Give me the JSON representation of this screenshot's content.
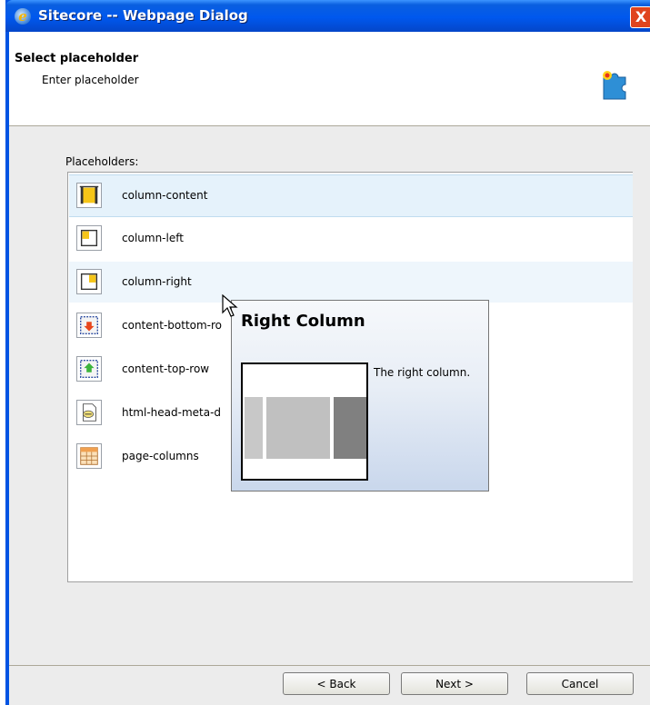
{
  "window": {
    "title": "Sitecore -- Webpage Dialog",
    "close_label": "X"
  },
  "header": {
    "title": "Select placeholder",
    "subtitle": "Enter placeholder"
  },
  "list": {
    "label": "Placeholders:",
    "items": [
      {
        "label": "column-content",
        "icon": "column-content-icon"
      },
      {
        "label": "column-left",
        "icon": "column-left-icon"
      },
      {
        "label": "column-right",
        "icon": "column-right-icon"
      },
      {
        "label": "content-bottom-ro",
        "icon": "content-bottom-row-icon"
      },
      {
        "label": "content-top-row",
        "icon": "content-top-row-icon"
      },
      {
        "label": "html-head-meta-d",
        "icon": "html-head-meta-icon"
      },
      {
        "label": "page-columns",
        "icon": "page-columns-icon"
      }
    ]
  },
  "tooltip": {
    "title": "Right Column",
    "description": "The right column."
  },
  "buttons": {
    "back": "< Back",
    "next": "Next >",
    "cancel": "Cancel"
  },
  "colors": {
    "titlebar": "#0058ee",
    "selection": "#e5f2fb",
    "close": "#e0441e"
  }
}
